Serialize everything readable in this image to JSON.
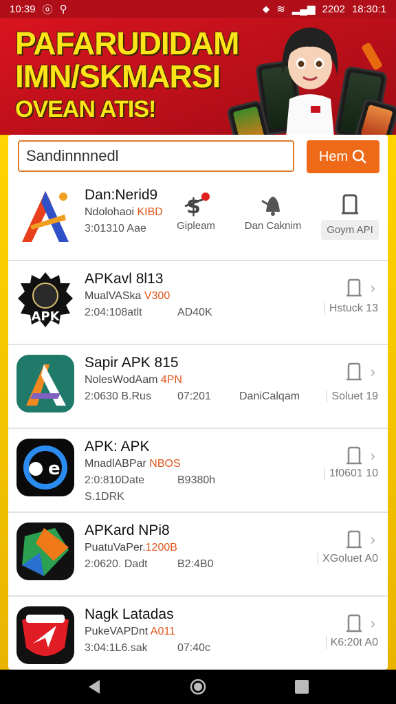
{
  "status_bar": {
    "time_left": "10:39",
    "carrier_right": "2202",
    "time_right": "18:30:1"
  },
  "banner": {
    "line1": "PAFARUDIDAM",
    "line2": "IMN/SKMARSI",
    "line3": "OVEAN ATIS!"
  },
  "search": {
    "value": "Sandinnnnedl",
    "button_label": "Hem"
  },
  "header_app": {
    "name": "Dan:Nerid9",
    "sub_prefix": "Ndolohaoi ",
    "sub_highlight": "KIBD",
    "meta": "3:01310 Aae",
    "actions": [
      {
        "label": "Gipleam",
        "icon": "price-icon"
      },
      {
        "label": "Dan Caknim",
        "icon": "bell-icon"
      },
      {
        "label": "Goym API",
        "icon": "bookmark-icon"
      }
    ]
  },
  "apps": [
    {
      "name": "APKavl 8l13",
      "sub_prefix": "MualVASka ",
      "sub_highlight": "V300",
      "date": "2:04:108atlt",
      "size": "AD40K",
      "category": "",
      "right": "Hstuck 13",
      "extra": ""
    },
    {
      "name": "Sapir APK 815",
      "sub_prefix": "NolesWodAam ",
      "sub_highlight": "4PN",
      "date": "2:0630 B.Rus",
      "size": "07:201",
      "category": "DaniCalqam",
      "right": "Soluet 19",
      "extra": ""
    },
    {
      "name": "APK: APK",
      "sub_prefix": "MnadlABPar ",
      "sub_highlight": "NBOS",
      "date": "2:0:810Date",
      "size": "B9380h",
      "category": "",
      "right": "1f0601 10",
      "extra": "S.1DRK"
    },
    {
      "name": "APKard NPi8",
      "sub_prefix": "PuatuVaPer.",
      "sub_highlight": "1200B",
      "date": "2:0620. Dadt",
      "size": "B2:4B0",
      "category": "",
      "right": "XGoluet A0",
      "extra": ""
    },
    {
      "name": "Nagk Latadas",
      "sub_prefix": "PukeVAPDnt ",
      "sub_highlight": "A011",
      "date": "3:04:1L6.sak",
      "size": "07:40c",
      "category": "",
      "right": "K6:20t A0",
      "extra": ""
    }
  ],
  "colors": {
    "accent": "#ef6a18",
    "banner_red": "#c8121c",
    "banner_yellow": "#ffe41a"
  }
}
